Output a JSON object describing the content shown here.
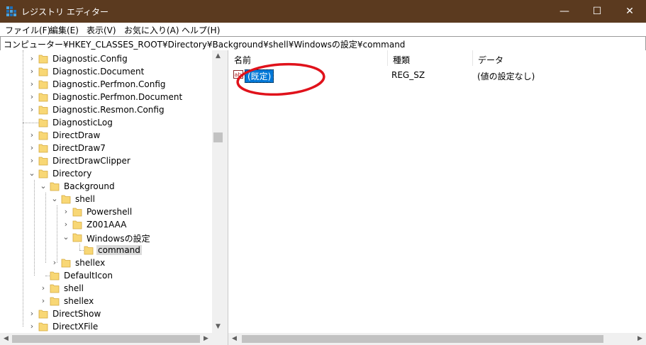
{
  "window": {
    "title": "レジストリ エディター",
    "controls": {
      "minimize": "—",
      "maximize": "☐",
      "close": "✕"
    }
  },
  "menu": [
    "ファイル(F)",
    "編集(E)",
    "表示(V)",
    "お気に入り(A)",
    "ヘルプ(H)"
  ],
  "address": "コンピューター¥HKEY_CLASSES_ROOT¥Directory¥Background¥shell¥Windowsの設定¥command",
  "tree": {
    "items": [
      {
        "label": "Diagnostic.Config",
        "expander": "›"
      },
      {
        "label": "Diagnostic.Document",
        "expander": "›"
      },
      {
        "label": "Diagnostic.Perfmon.Config",
        "expander": "›"
      },
      {
        "label": "Diagnostic.Perfmon.Document",
        "expander": "›"
      },
      {
        "label": "Diagnostic.Resmon.Config",
        "expander": "›"
      },
      {
        "label": "DiagnosticLog",
        "expander": ""
      },
      {
        "label": "DirectDraw",
        "expander": "›"
      },
      {
        "label": "DirectDraw7",
        "expander": "›"
      },
      {
        "label": "DirectDrawClipper",
        "expander": "›"
      },
      {
        "label": "Directory",
        "expander": "⌄"
      },
      {
        "label": "Background",
        "expander": "⌄"
      },
      {
        "label": "shell",
        "expander": "⌄"
      },
      {
        "label": "Powershell",
        "expander": "›"
      },
      {
        "label": "Z001AAA",
        "expander": "›"
      },
      {
        "label": "Windowsの設定",
        "expander": "⌄"
      },
      {
        "label": "command",
        "expander": ""
      },
      {
        "label": "shellex",
        "expander": "›"
      },
      {
        "label": "DefaultIcon",
        "expander": ""
      },
      {
        "label": "shell",
        "expander": "›"
      },
      {
        "label": "shellex",
        "expander": "›"
      },
      {
        "label": "DirectShow",
        "expander": "›"
      },
      {
        "label": "DirectXFile",
        "expander": "›"
      }
    ],
    "scroll": {
      "up": "▲",
      "down": "▼",
      "left": "◀",
      "right": "▶"
    }
  },
  "list": {
    "columns": {
      "name": "名前",
      "type": "種類",
      "data": "データ"
    },
    "rows": [
      {
        "name": "(既定)",
        "type": "REG_SZ",
        "data": "(値の設定なし)",
        "icon": "string-value-icon"
      }
    ],
    "scroll": {
      "left": "◀",
      "right": "▶"
    }
  },
  "colors": {
    "titlebar": "#5b3a1f",
    "selection": "#0078d7",
    "annotation": "#e0121b",
    "folder": "#f8d775"
  }
}
